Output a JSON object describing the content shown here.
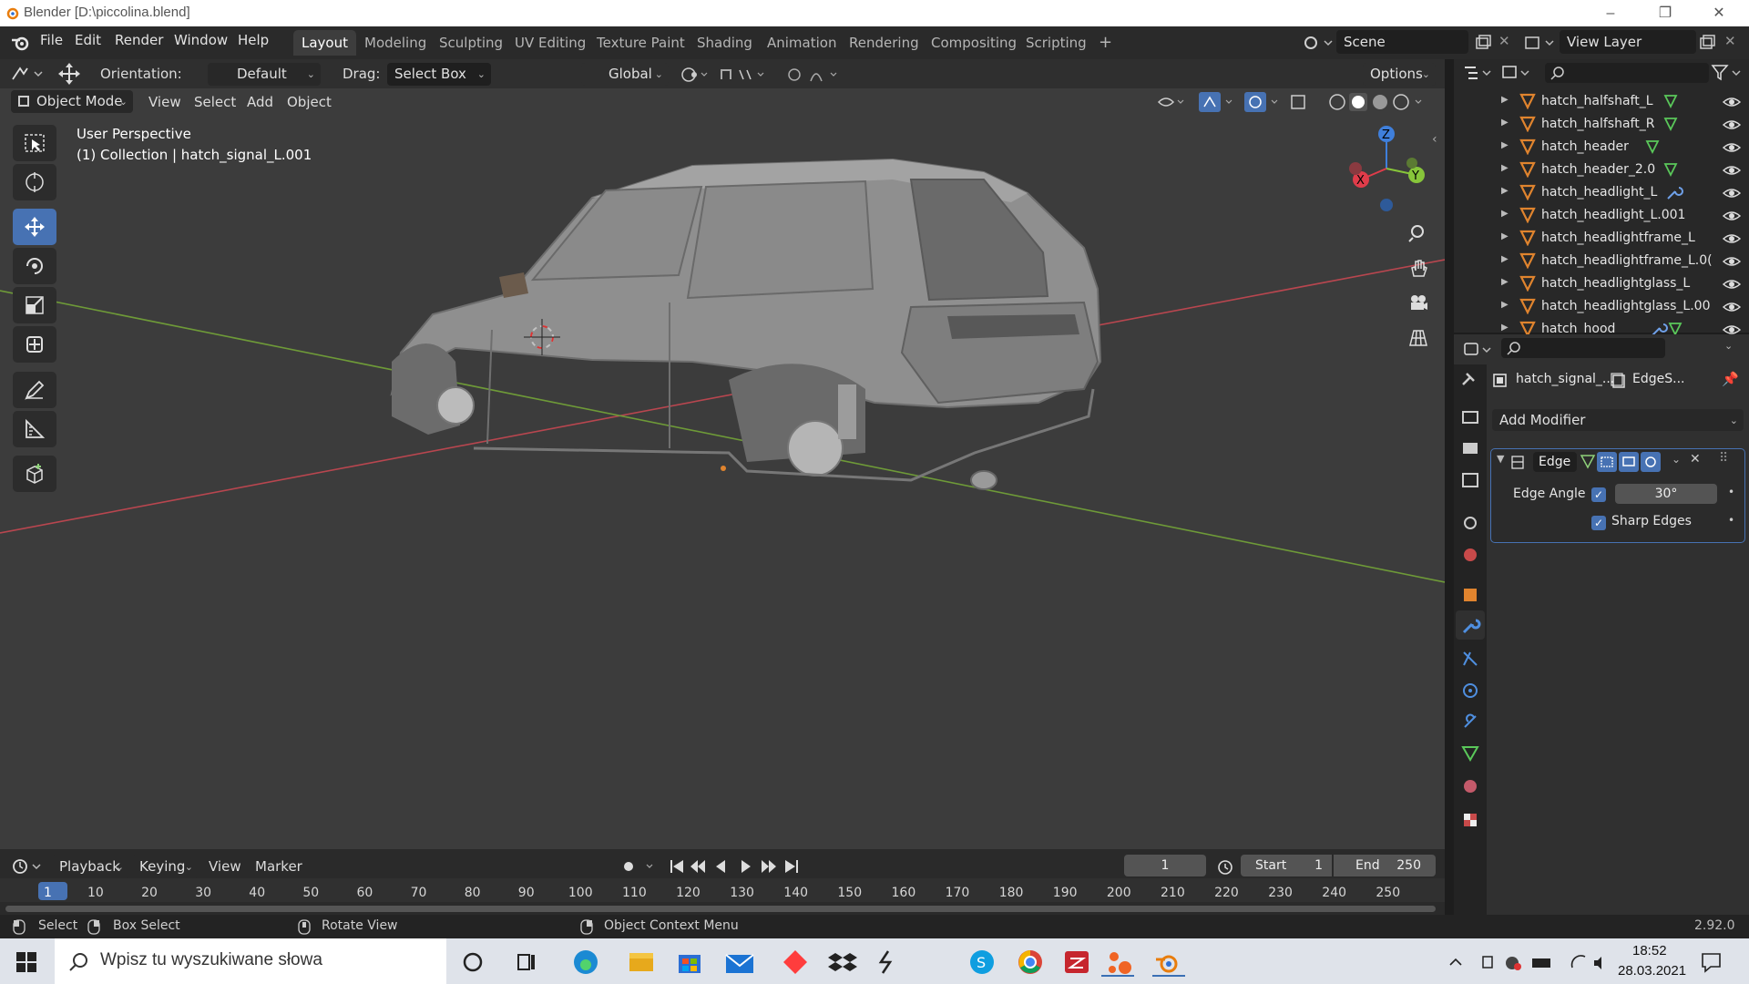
{
  "window": {
    "title": "Blender [D:\\piccolina.blend]",
    "min": "–",
    "max": "❐",
    "close": "✕"
  },
  "menu": [
    "File",
    "Edit",
    "Render",
    "Window",
    "Help"
  ],
  "workspaces": [
    {
      "label": "Layout",
      "active": true
    },
    {
      "label": "Modeling"
    },
    {
      "label": "Sculpting"
    },
    {
      "label": "UV Editing"
    },
    {
      "label": "Texture Paint"
    },
    {
      "label": "Shading"
    },
    {
      "label": "Animation"
    },
    {
      "label": "Rendering"
    },
    {
      "label": "Compositing"
    },
    {
      "label": "Scripting"
    }
  ],
  "add_workspace": "+",
  "scene": {
    "label": "Scene"
  },
  "view_layer": {
    "label": "View Layer"
  },
  "toolbar": {
    "orientation_label": "Orientation:",
    "orientation_value": "Default",
    "drag_label": "Drag:",
    "drag_value": "Select Box",
    "transform_value": "Global",
    "options": "Options"
  },
  "header2": {
    "mode": "Object Mode",
    "view": "View",
    "select": "Select",
    "add": "Add",
    "object": "Object"
  },
  "viewport": {
    "perspective": "User Perspective",
    "collection": "(1) Collection | hatch_signal_L.001",
    "gizmo": {
      "x": "X",
      "y": "Y",
      "z": "Z"
    }
  },
  "outliner": {
    "items": [
      {
        "name": "hatch_halfshaft_L",
        "extra": "mesh"
      },
      {
        "name": "hatch_halfshaft_R",
        "extra": "mesh"
      },
      {
        "name": "hatch_header",
        "extra": "mesh"
      },
      {
        "name": "hatch_header_2.0",
        "extra": "mesh"
      },
      {
        "name": "hatch_headlight_L",
        "extra": "wrench"
      },
      {
        "name": "hatch_headlight_L.001",
        "extra": ""
      },
      {
        "name": "hatch_headlightframe_L",
        "extra": ""
      },
      {
        "name": "hatch_headlightframe_L.0(",
        "extra": ""
      },
      {
        "name": "hatch_headlightglass_L",
        "extra": ""
      },
      {
        "name": "hatch_headlightglass_L.00",
        "extra": ""
      },
      {
        "name": "hatch_hood",
        "extra": "wrench-mesh"
      }
    ]
  },
  "properties": {
    "object_name": "hatch_signal_...",
    "modifier_name": "EdgeS...",
    "add_modifier": "Add Modifier",
    "modifier_panel": {
      "name": "Edge",
      "edge_angle_label": "Edge Angle",
      "edge_angle_enabled": true,
      "edge_angle_value": "30°",
      "sharp_edges_label": "Sharp Edges",
      "sharp_edges_enabled": true
    }
  },
  "timeline": {
    "playback": "Playback",
    "keying": "Keying",
    "view": "View",
    "marker": "Marker",
    "current_frame": "1",
    "start_label": "Start",
    "start_value": "1",
    "end_label": "End",
    "end_value": "250",
    "ticks": [
      "1",
      "10",
      "20",
      "30",
      "40",
      "50",
      "60",
      "70",
      "80",
      "90",
      "100",
      "110",
      "120",
      "130",
      "140",
      "150",
      "160",
      "170",
      "180",
      "190",
      "200",
      "210",
      "220",
      "230",
      "240",
      "250"
    ]
  },
  "status": {
    "select": "Select",
    "box_select": "Box Select",
    "rotate_view": "Rotate View",
    "context_menu": "Object Context Menu",
    "version": "2.92.0"
  },
  "taskbar": {
    "search_placeholder": "Wpisz tu wyszukiwane słowa",
    "time": "18:52",
    "date": "28.03.2021"
  },
  "colors": {
    "accent": "#4772b3",
    "x_axis": "#e03c4a",
    "y_axis": "#87c53a",
    "z_axis": "#3f7fdb",
    "object_orange": "#e0842e",
    "mesh_green": "#5ac85a"
  }
}
